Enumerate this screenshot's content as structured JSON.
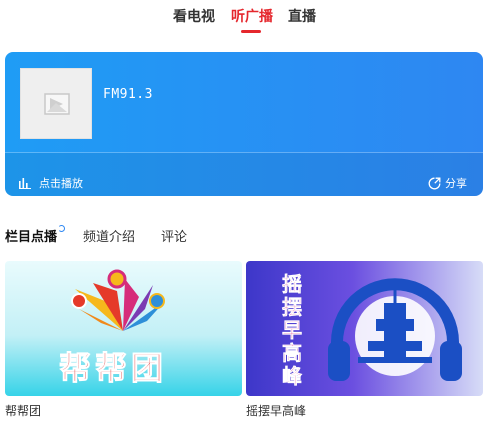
{
  "top_tabs": [
    {
      "label": "看电视",
      "active": false
    },
    {
      "label": "听广播",
      "active": true
    },
    {
      "label": "直播",
      "active": false
    }
  ],
  "player": {
    "station_name": "FM91.3",
    "play_label": "点击播放",
    "share_label": "分享",
    "cover_icon": "image-placeholder-icon",
    "play_icon": "audio-bars-icon",
    "share_icon": "share-icon",
    "gradient_start": "#1f9cf5",
    "gradient_end": "#2e87f2"
  },
  "section_tabs": [
    {
      "label": "栏目点播",
      "active": true
    },
    {
      "label": "频道介绍",
      "active": false
    },
    {
      "label": "评论",
      "active": false
    }
  ],
  "programs": [
    {
      "title": "帮帮团",
      "logo_text": "帮帮团"
    },
    {
      "title": "摇摆早高峰",
      "logo_text": "摇摆早高峰"
    }
  ],
  "colors": {
    "accent_red": "#e5272d",
    "accent_blue": "#2e87f2"
  }
}
